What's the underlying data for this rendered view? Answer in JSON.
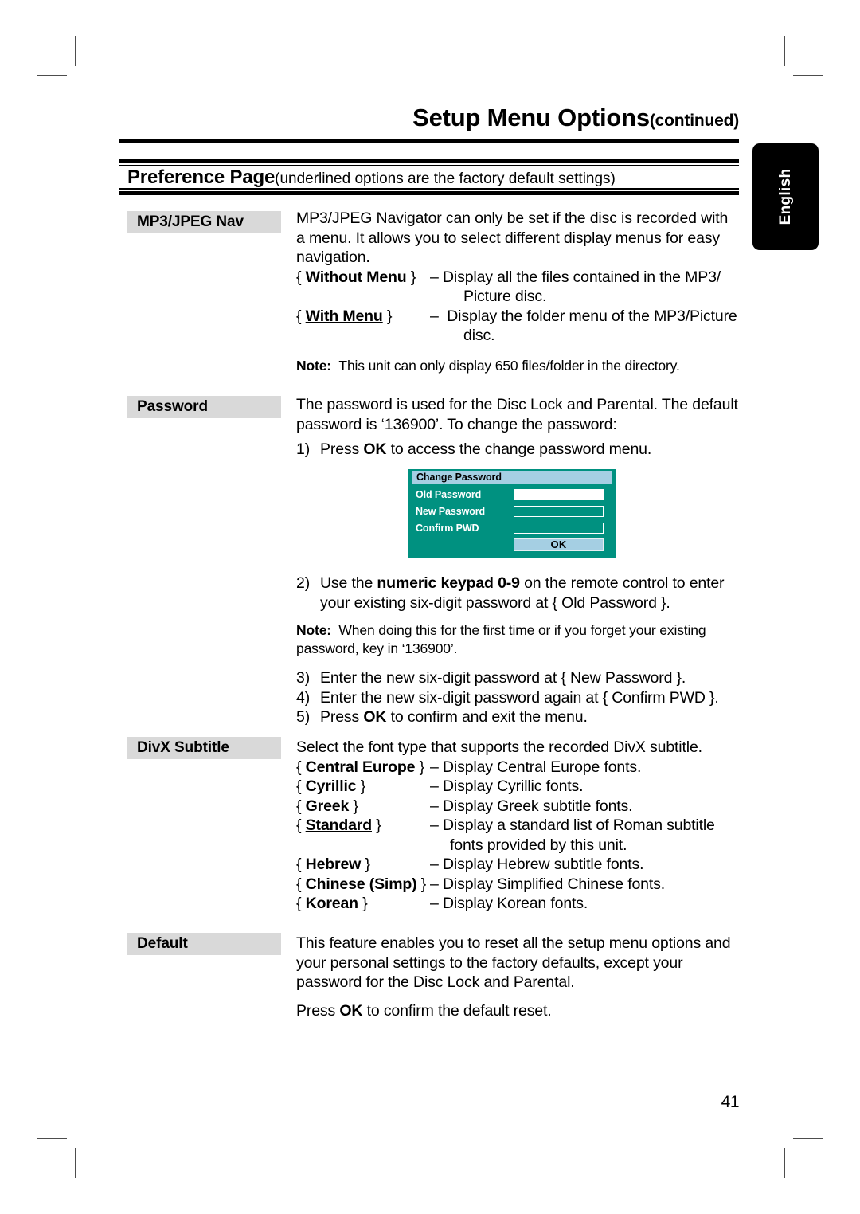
{
  "header": {
    "title": "Setup Menu Options",
    "title_suffix": "(continued)",
    "section_title": "Preference Page",
    "section_subtitle": "(underlined options are the factory default settings)"
  },
  "side_tab": {
    "label": "English"
  },
  "sections": {
    "mp3jpeg": {
      "label": "MP3/JPEG Nav",
      "intro": "MP3/JPEG Navigator can only be set if the disc is recorded with a menu. It allows you to select different display menus for easy navigation.",
      "options": [
        {
          "open_brace": "{",
          "name": "Without Menu",
          "close_brace": "}",
          "underlined": false,
          "dash": "–",
          "desc_line1": "Display all the files contained in the MP3/",
          "desc_line2": "Picture disc."
        },
        {
          "open_brace": "{",
          "name": "With Menu",
          "close_brace": "}",
          "underlined": true,
          "dash": "–",
          "desc_line1": "Display the folder menu of the MP3/Picture",
          "desc_line2": "disc."
        }
      ],
      "note_label": "Note:",
      "note_text": "This unit can only display 650 files/folder in the directory."
    },
    "password": {
      "label": "Password",
      "intro": "The password is used for the Disc Lock and Parental. The default password is ‘136900’. To change the password:",
      "step1_num": "1)",
      "step1_pre": "Press ",
      "step1_bold": "OK",
      "step1_post": " to access the change password menu.",
      "step2_num": "2)",
      "step2_pre": "Use the ",
      "step2_bold": "numeric keypad 0-9",
      "step2_post": " on the remote control to enter your existing six-digit password at { Old Password }.",
      "note_label": "Note:",
      "note_text": "When doing this for the first time or if you forget your existing password, key in ‘136900’.",
      "step3_num": "3)",
      "step3_text": "Enter the new six-digit password at { New Password }.",
      "step4_num": "4)",
      "step4_text": "Enter the new six-digit password again at { Confirm PWD }.",
      "step5_num": "5)",
      "step5_pre": "Press ",
      "step5_bold": "OK",
      "step5_post": " to confirm and exit the menu."
    },
    "divx": {
      "label": "DivX Subtitle",
      "intro": "Select the font type that supports the recorded DivX subtitle.",
      "options": [
        {
          "open_brace": "{",
          "name": "Central Europe",
          "close_brace": "}",
          "underlined": false,
          "dash": "–",
          "desc_line1": "Display Central Europe fonts.",
          "desc_line2": ""
        },
        {
          "open_brace": "{",
          "name": "Cyrillic",
          "close_brace": "}",
          "underlined": false,
          "dash": "–",
          "desc_line1": "Display Cyrillic fonts.",
          "desc_line2": ""
        },
        {
          "open_brace": "{",
          "name": "Greek",
          "close_brace": "}",
          "underlined": false,
          "dash": "–",
          "desc_line1": "Display Greek subtitle fonts.",
          "desc_line2": ""
        },
        {
          "open_brace": "{",
          "name": "Standard",
          "close_brace": "}",
          "underlined": true,
          "dash": "–",
          "desc_line1": "Display a standard list of Roman subtitle",
          "desc_line2": "fonts provided by this unit."
        },
        {
          "open_brace": "{",
          "name": "Hebrew",
          "close_brace": "}",
          "underlined": false,
          "dash": "–",
          "desc_line1": "Display Hebrew subtitle fonts.",
          "desc_line2": ""
        },
        {
          "open_brace": "{",
          "name": "Chinese (Simp)",
          "close_brace": "}",
          "underlined": false,
          "dash": "–",
          "desc_line1": "Display Simplified Chinese fonts.",
          "desc_line2": ""
        },
        {
          "open_brace": "{",
          "name": "Korean",
          "close_brace": "}",
          "underlined": false,
          "dash": "–",
          "desc_line1": "Display Korean fonts.",
          "desc_line2": ""
        }
      ]
    },
    "default": {
      "label": "Default",
      "intro": "This feature enables you to reset all the setup menu options and your personal settings to the factory defaults, except your password for the Disc Lock and Parental.",
      "confirm_pre": "Press ",
      "confirm_bold": "OK",
      "confirm_post": " to confirm the default reset."
    }
  },
  "dialog": {
    "title": "Change Password",
    "rows": [
      {
        "label": "Old Password",
        "value": "",
        "focused": true
      },
      {
        "label": "New Password",
        "value": "",
        "focused": false
      },
      {
        "label": "Confirm PWD",
        "value": "",
        "focused": false
      }
    ],
    "ok_label": "OK",
    "colors": {
      "body": "#009180",
      "title_bar": "#a5cfe3",
      "button": "#a5cfe3",
      "field_active": "#ffffff"
    }
  },
  "footer": {
    "page_number": "41"
  }
}
